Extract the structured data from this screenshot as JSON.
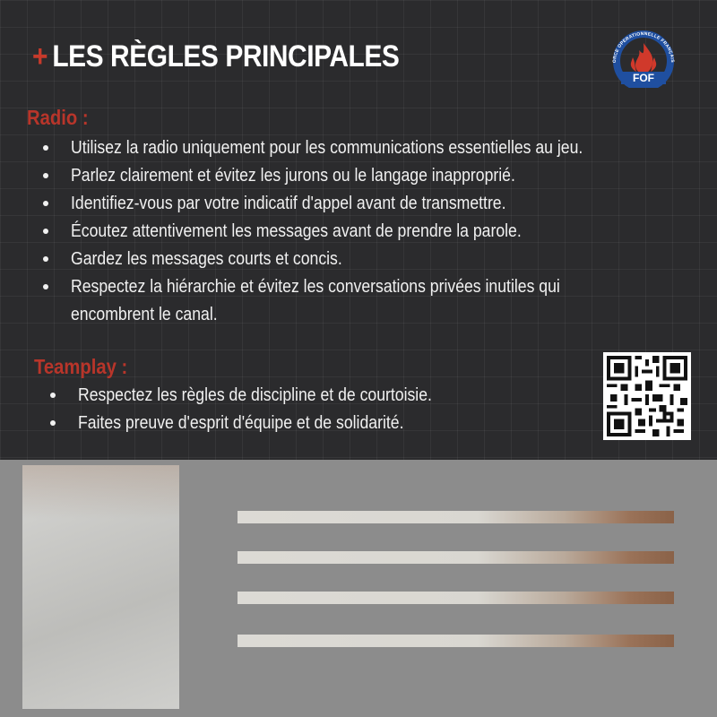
{
  "title": {
    "plus": "+",
    "text": "LES RÈGLES PRINCIPALES"
  },
  "logo": {
    "text": "FOF",
    "arc_text": "FORCE OPERATIONNELLE FRANÇAISE",
    "color": "#1f4fa0",
    "flame_color": "#d0392b"
  },
  "radio": {
    "heading": "Radio :",
    "items": [
      "Utilisez la radio uniquement pour les communications essentielles au jeu.",
      "Parlez clairement et évitez les jurons ou le langage inapproprié.",
      "Identifiez-vous par votre indicatif d'appel avant de transmettre.",
      "Écoutez attentivement les messages avant de prendre la parole.",
      "Gardez les messages courts et concis.",
      "Respectez la hiérarchie et évitez les conversations privées inutiles qui",
      "encombrent le canal."
    ]
  },
  "teamplay": {
    "heading": "Teamplay :",
    "items": [
      "Respectez les règles de discipline et de courtoisie.",
      "Faites preuve d'esprit d'équipe et de solidarité."
    ]
  },
  "colors": {
    "accent": "#b8352a",
    "background": "#2b2b2d",
    "text": "#f1f1f1"
  },
  "icons": [
    "fof-logo-icon",
    "qr-code-icon"
  ]
}
